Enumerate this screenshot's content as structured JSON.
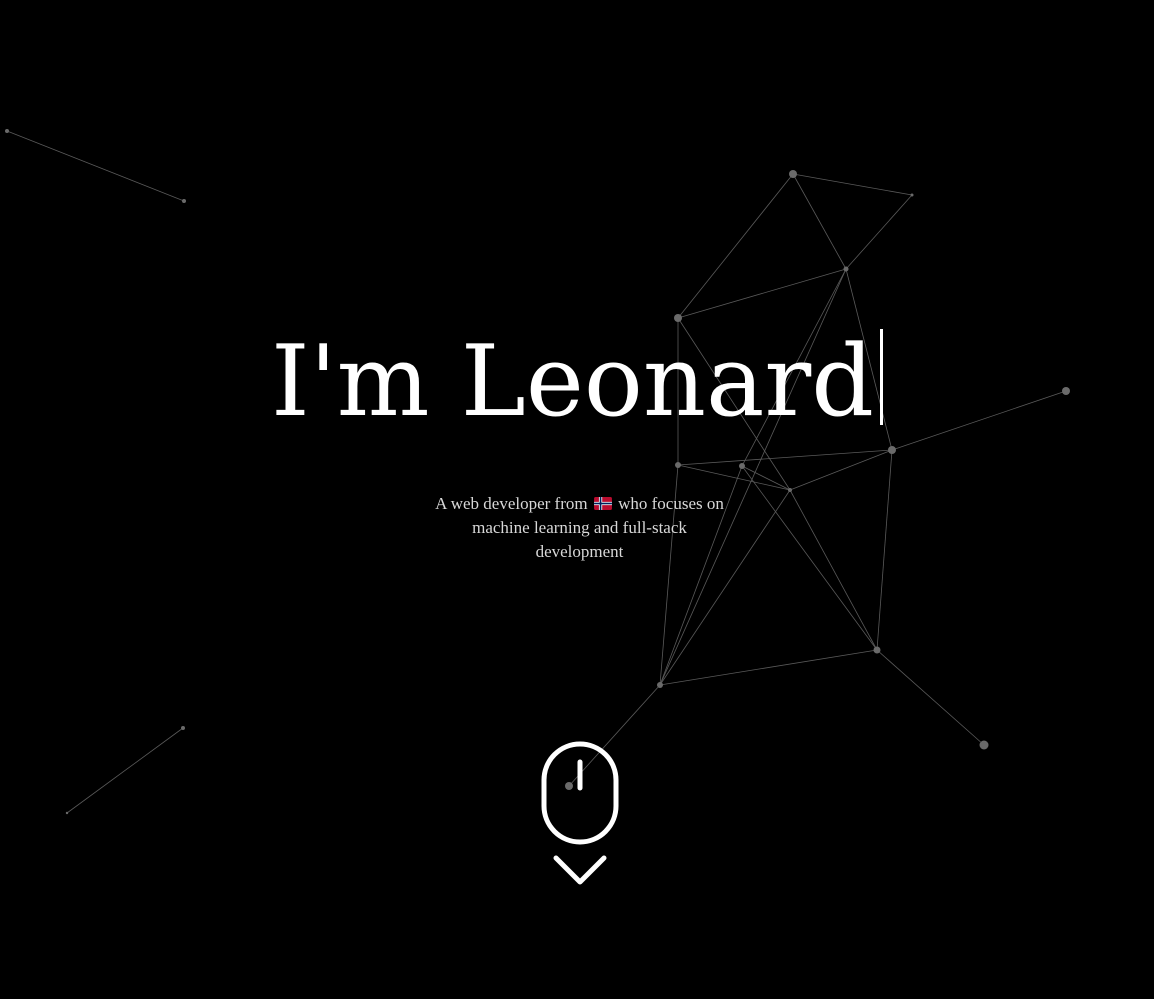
{
  "hero": {
    "greeting": "I'm Leonard",
    "tagline_before_flag": "A web developer from",
    "flag_icon": "norway-flag-icon",
    "tagline_after_flag": "who focuses on machine learning and full-stack development"
  },
  "scroll_indicator": {
    "mouse_icon": "mouse-icon",
    "arrow_icon": "chevron-down-icon"
  },
  "colors": {
    "background": "#000000",
    "text": "#ffffff",
    "tagline": "#d8d8d8",
    "network_line": "#5a5a5a",
    "network_node": "#6a6a6a"
  }
}
